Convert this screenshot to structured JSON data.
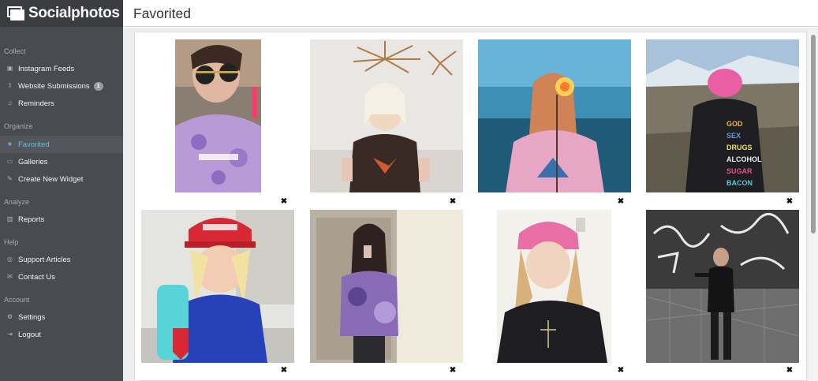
{
  "brand": {
    "name": "Socialphotos"
  },
  "sidebar": {
    "sections": [
      {
        "label": "Collect"
      },
      {
        "label": "Organize"
      },
      {
        "label": "Analyze"
      },
      {
        "label": "Help"
      },
      {
        "label": "Account"
      }
    ],
    "items": [
      {
        "label": "Instagram Feeds",
        "icon": "instagram-icon"
      },
      {
        "label": "Website Submissions",
        "icon": "upload-icon",
        "badge": "1"
      },
      {
        "label": "Reminders",
        "icon": "bell-icon"
      },
      {
        "label": "Favorited",
        "icon": "star-icon",
        "active": true
      },
      {
        "label": "Galleries",
        "icon": "folder-icon"
      },
      {
        "label": "Create New Widget",
        "icon": "pencil-icon"
      },
      {
        "label": "Reports",
        "icon": "bar-chart-icon"
      },
      {
        "label": "Support Articles",
        "icon": "lifebuoy-icon"
      },
      {
        "label": "Contact Us",
        "icon": "envelope-icon"
      },
      {
        "label": "Settings",
        "icon": "gear-icon"
      },
      {
        "label": "Logout",
        "icon": "logout-icon"
      }
    ]
  },
  "header": {
    "title": "Favorited"
  },
  "gallery": {
    "remove_symbol": "✖",
    "photos": [
      {
        "id": "photo-1"
      },
      {
        "id": "photo-2"
      },
      {
        "id": "photo-3"
      },
      {
        "id": "photo-4"
      },
      {
        "id": "photo-5"
      },
      {
        "id": "photo-6"
      },
      {
        "id": "photo-7"
      },
      {
        "id": "photo-8"
      }
    ]
  }
}
